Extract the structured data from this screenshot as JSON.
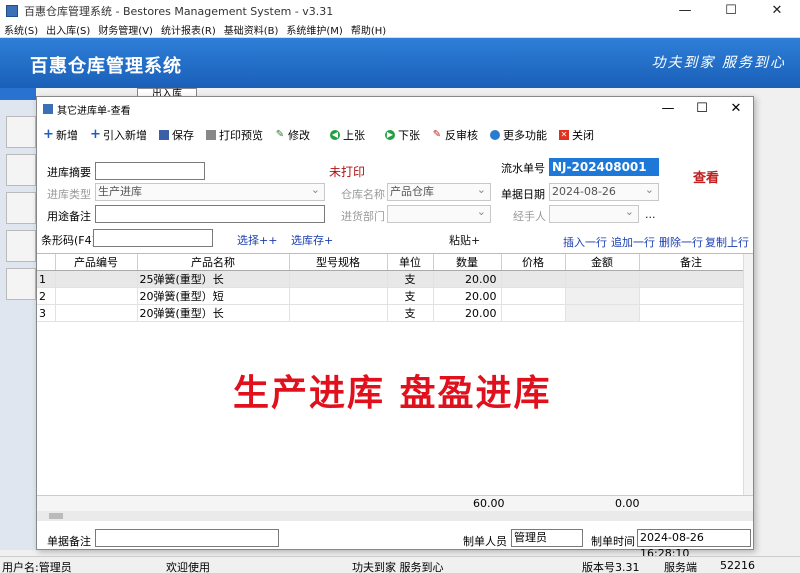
{
  "window": {
    "title": "百惠仓库管理系统 - Bestores Management System - v3.31",
    "minimize": "—",
    "maximize": "☐",
    "close": "✕"
  },
  "menu": [
    "系统(S)",
    "出入库(S)",
    "财务管理(V)",
    "统计报表(R)",
    "基础资料(B)",
    "系统维护(M)",
    "帮助(H)"
  ],
  "banner": {
    "title": "百惠仓库管理系统",
    "slogan": "功夫到家 服务到心"
  },
  "background_tab": "出入库",
  "dialog": {
    "title": "其它进库单-查看",
    "minimize": "—",
    "maximize": "☐",
    "close": "✕"
  },
  "toolbar": {
    "new": "新增",
    "import_new": "引入新增",
    "save": "保存",
    "print_preview": "打印预览",
    "edit": "修改",
    "prev": "上张",
    "next": "下张",
    "unreview": "反审核",
    "more": "更多功能",
    "close": "关闭"
  },
  "form": {
    "summary_label": "进库摘要",
    "summary_value": "",
    "print_status": "未打印",
    "serial_label": "流水单号",
    "serial_value": "NJ-202408001",
    "mode": "查看",
    "type_label": "进库类型",
    "type_value": "生产进库",
    "warehouse_label": "仓库名称",
    "warehouse_value": "产品仓库",
    "date_label": "单据日期",
    "date_value": "2024-08-26",
    "remark_label": "用途备注",
    "remark_value": "",
    "dept_label": "进货部门",
    "dept_value": "",
    "handler_label": "经手人",
    "handler_value": "",
    "handler_more": "...",
    "barcode_label": "条形码(F4)",
    "barcode_value": "",
    "select_link": "选择++",
    "select_stock_link": "选库存+",
    "paste_label": "粘贴+",
    "insert_row": "插入一行",
    "append_row": "追加一行",
    "delete_row": "删除一行",
    "copy_row": "复制上行"
  },
  "grid": {
    "columns": [
      "",
      "产品编号",
      "产品名称",
      "型号规格",
      "单位",
      "数量",
      "价格",
      "金额",
      "备注"
    ],
    "rows": [
      {
        "no": "1",
        "code": "",
        "name": "25弹簧(重型）长",
        "spec": "",
        "unit": "支",
        "qty": "20.00",
        "price": "",
        "amount": "",
        "remark": ""
      },
      {
        "no": "2",
        "code": "",
        "name": "20弹簧(重型）短",
        "spec": "",
        "unit": "支",
        "qty": "20.00",
        "price": "",
        "amount": "",
        "remark": ""
      },
      {
        "no": "3",
        "code": "",
        "name": "20弹簧(重型）长",
        "spec": "",
        "unit": "支",
        "qty": "20.00",
        "price": "",
        "amount": "",
        "remark": ""
      }
    ],
    "overlay": "生产进库  盘盈进库",
    "total_qty": "60.00",
    "total_amount": "0.00"
  },
  "footer": {
    "note_label": "单据备注",
    "note_value": "",
    "creator_label": "制单人员",
    "creator_value": "管理员",
    "time_label": "制单时间",
    "time_value": "2024-08-26 16:28:10"
  },
  "status": {
    "user": "用户名:管理员",
    "welcome": "欢迎使用",
    "slogan": "功夫到家 服务到心",
    "version": "版本号3.31",
    "port": "52216",
    "side": "服务端"
  }
}
